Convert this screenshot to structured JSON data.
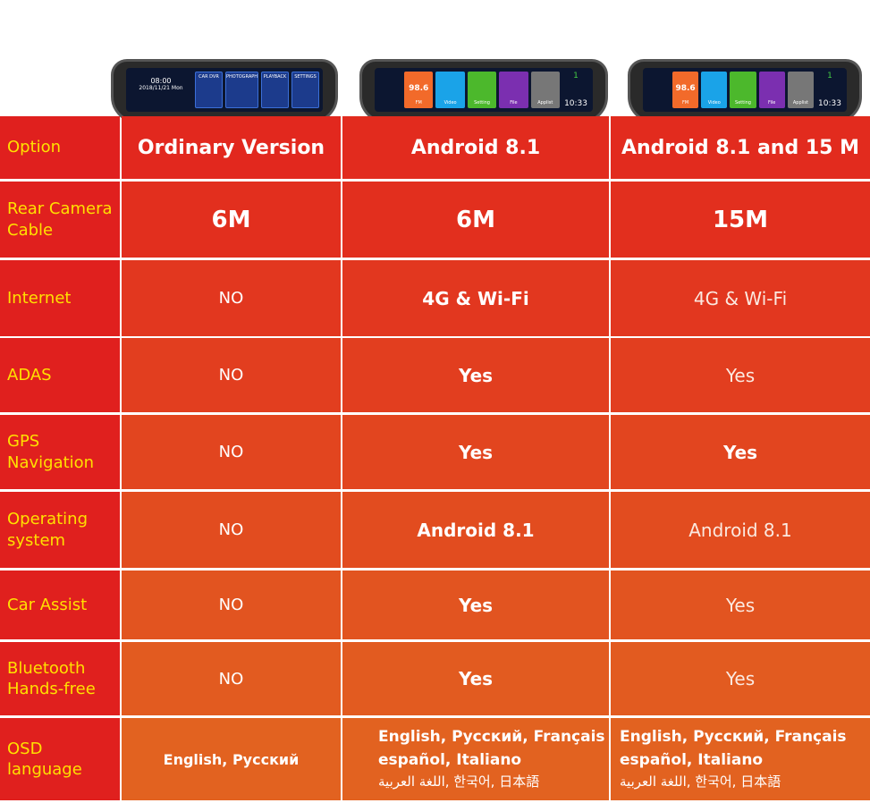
{
  "devices": [
    {
      "tiles": [
        "CAR DVR",
        "PHOTOGRAPH",
        "PLAYBACK",
        "SETTINGS"
      ],
      "time": "08:00",
      "date": "2018/11/21 Mon"
    },
    {
      "tiles": [
        "FM",
        "Video",
        "Setting",
        "File",
        "Applist"
      ],
      "fm": "98.6",
      "time": "10:33",
      "speed": "1"
    },
    {
      "tiles": [
        "FM",
        "Video",
        "Setting",
        "File",
        "Applist"
      ],
      "fm": "98.6",
      "time": "10:33",
      "speed": "1"
    }
  ],
  "header": {
    "option": "Option",
    "col1": "Ordinary Version",
    "col2": "Android 8.1",
    "col3": "Android 8.1 and 15 M"
  },
  "rows": [
    {
      "label": "Rear Camera Cable",
      "v1": "6M",
      "v2": "6M",
      "v3": "15M"
    },
    {
      "label": "Internet",
      "v1": "NO",
      "v2": "4G & Wi-Fi",
      "v3": "4G & Wi-Fi"
    },
    {
      "label": "ADAS",
      "v1": "NO",
      "v2": "Yes",
      "v3": "Yes"
    },
    {
      "label": "GPS Navigation",
      "v1": "NO",
      "v2": "Yes",
      "v3": "Yes"
    },
    {
      "label": "Operating system",
      "v1": "NO",
      "v2": "Android 8.1",
      "v3": "Android 8.1"
    },
    {
      "label": "Car Assist",
      "v1": "NO",
      "v2": "Yes",
      "v3": "Yes"
    },
    {
      "label": "Bluetooth Hands-free",
      "v1": "NO",
      "v2": "Yes",
      "v3": "Yes"
    }
  ],
  "osd": {
    "label": "OSD language",
    "v1": "English, Русский",
    "v2": [
      "English, Русский, Français",
      "español, Italiano",
      "اللغة العربية, 한국어, 日本語"
    ],
    "v3": [
      "English, Русский, Français",
      "español, Italiano",
      "اللغة العربية, 한국어, 日本語"
    ]
  },
  "colors": {
    "label_bg": "#e0201e",
    "label_text": "#ffe000",
    "top_cell": "#e2281e",
    "bottom_cell": "#e0601e"
  }
}
